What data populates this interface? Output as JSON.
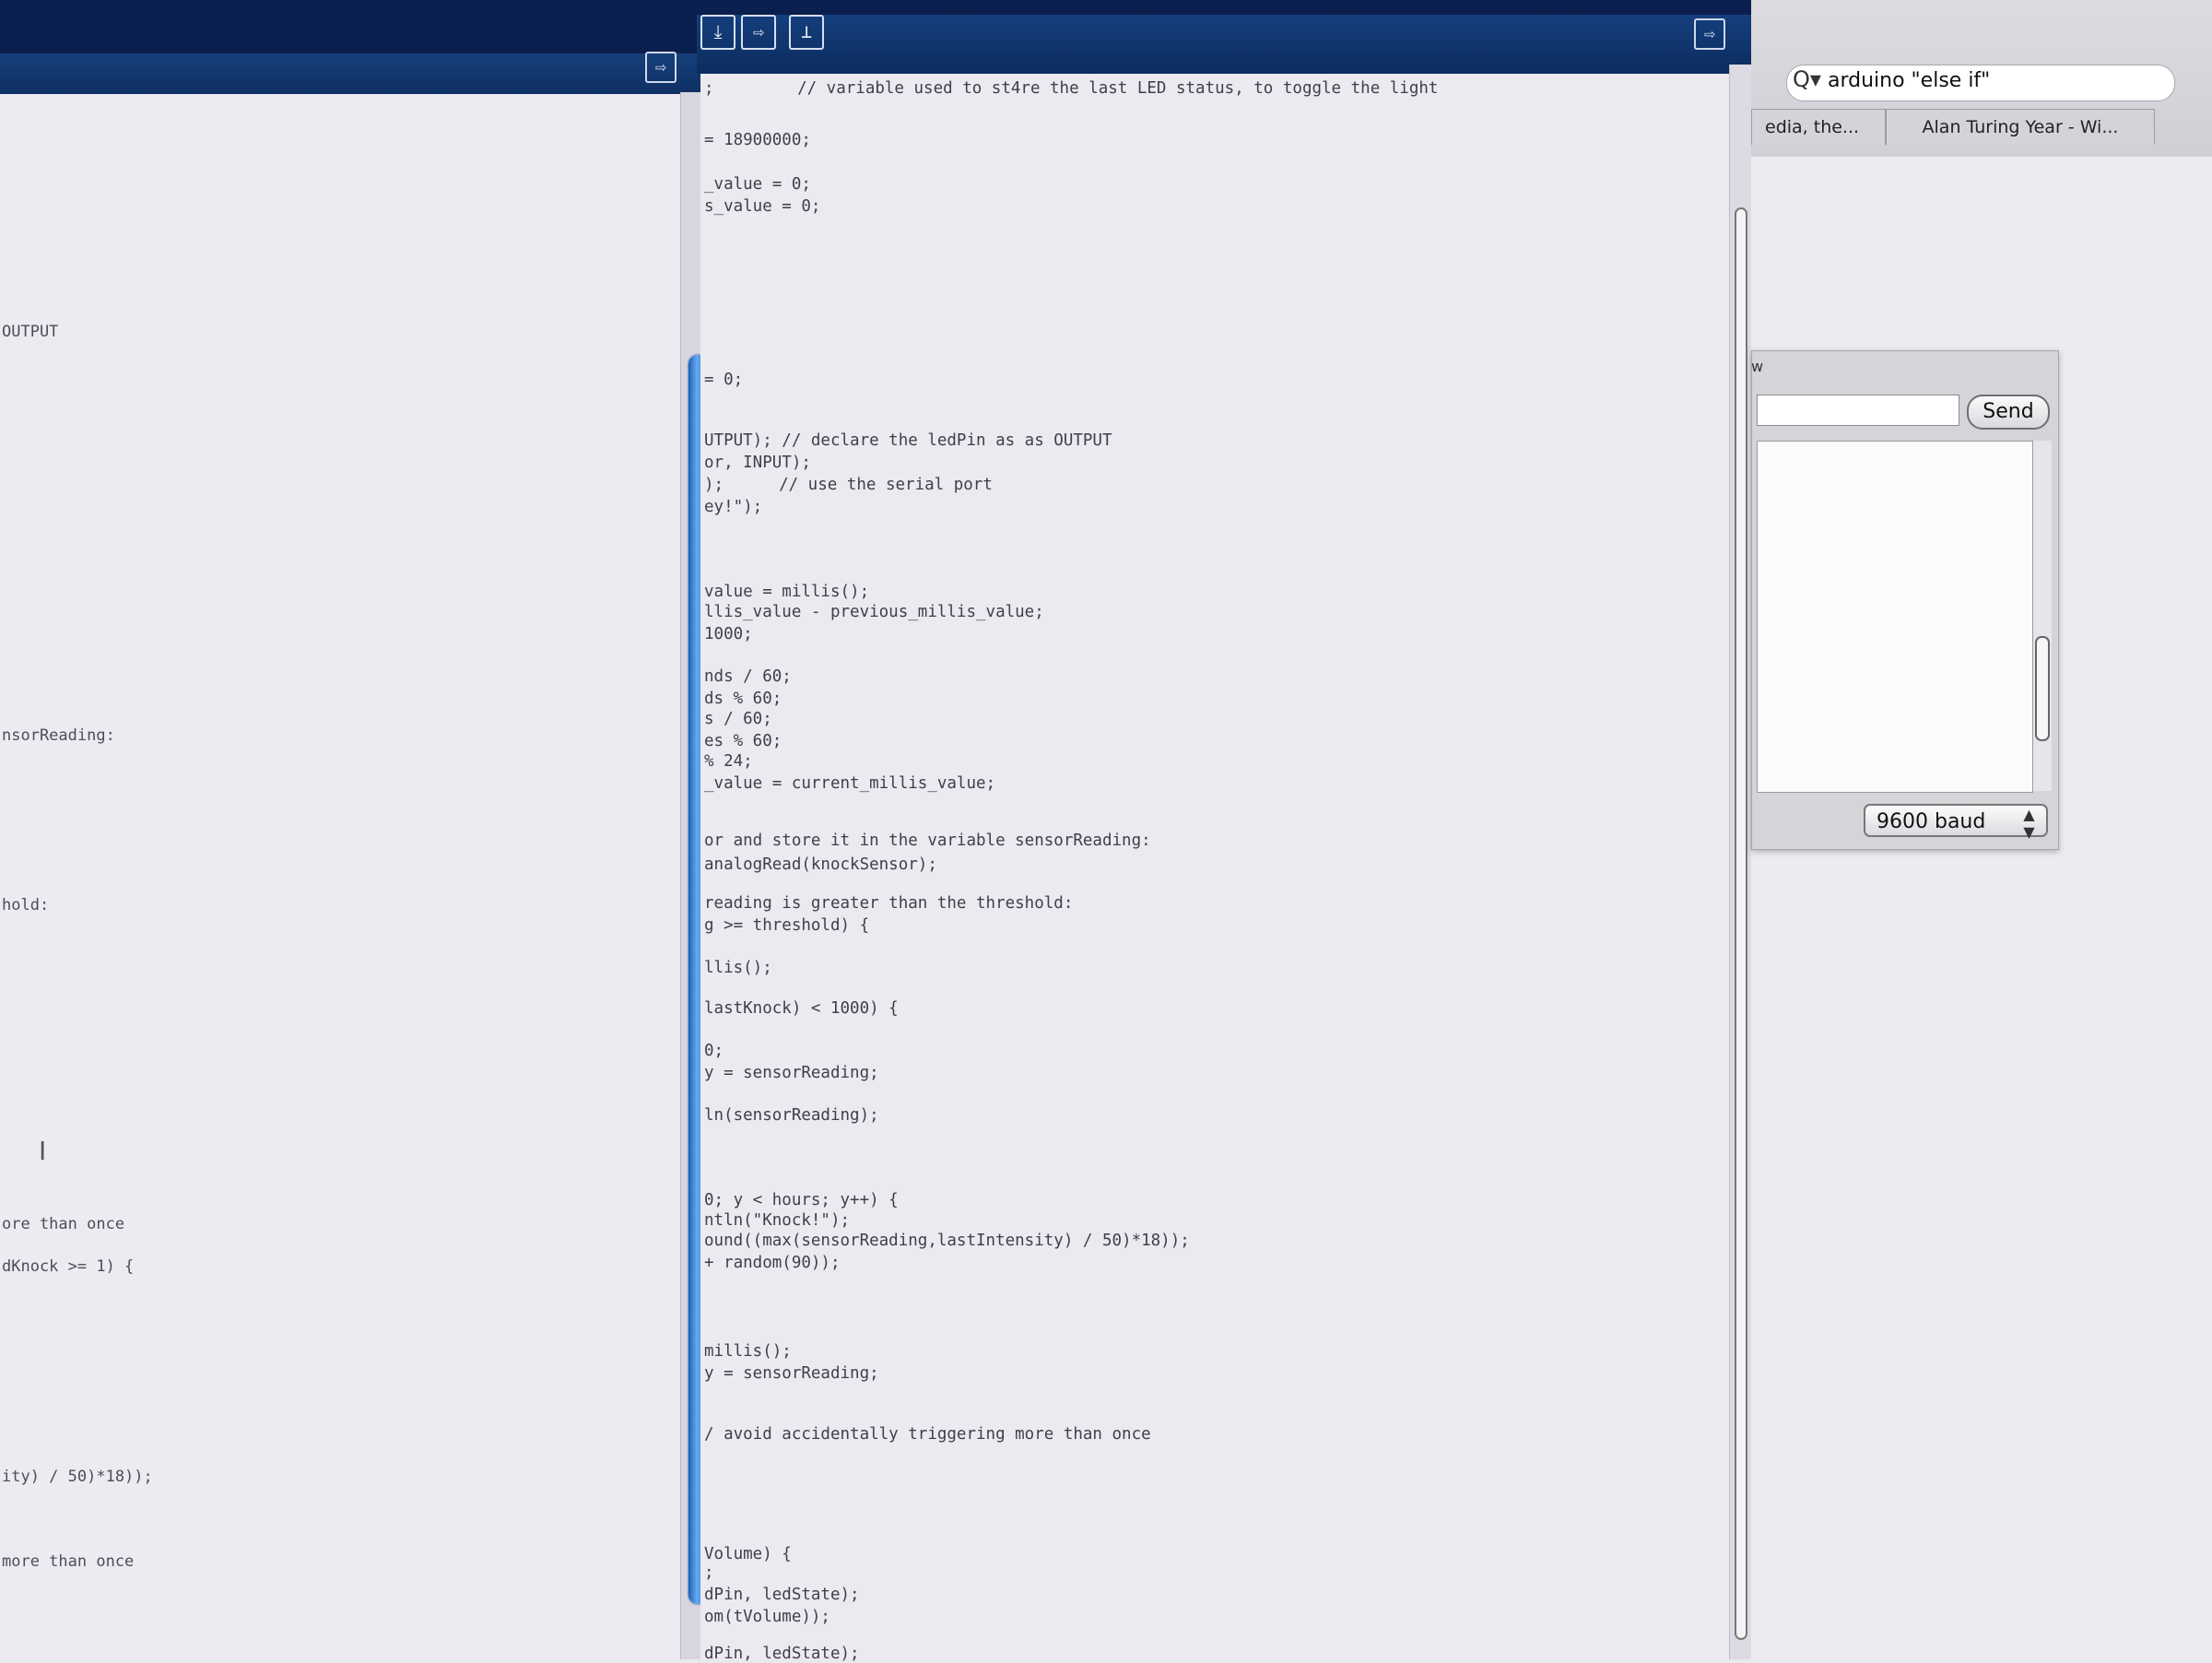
{
  "left_editor": {
    "lines": [
      "OUTPUT",
      "nsorReading:",
      "hold:",
      "ore than once",
      "dKnock >= 1) {",
      "ity) / 50)*18));",
      "more than once"
    ]
  },
  "center_editor": {
    "lines": [
      "; ",
      "= 18900000;",
      "_value = 0;",
      "s_value = 0;",
      "= 0;",
      "UTPUT); // declare the ledPin as as OUTPUT",
      "or, INPUT);",
      ");",
      "ey!\");",
      "value = millis();",
      "llis_value - previous_millis_value;",
      "1000;",
      "nds / 60;",
      "ds % 60;",
      "s / 60;",
      "es % 60;",
      "% 24;",
      "_value = current_millis_value;",
      "or and store it in the variable sensorReading:",
      "analogRead(knockSensor);",
      "reading is greater than the threshold:",
      "g >= threshold) {",
      "llis();",
      "lastKnock) < 1000) {",
      "0;",
      "y = sensorReading;",
      "ln(sensorReading);",
      "0; y < hours; y++) {",
      "ntln(\"Knock!\");",
      "ound((max(sensorReading,lastIntensity) / 50)*18));",
      "+ random(90));",
      "millis();",
      "y = sensorReading;",
      "/ avoid accidentally triggering more than once",
      "Volume) {",
      ";",
      "dPin, ledState);",
      "om(tVolume));",
      "dPin, ledState);"
    ],
    "comments": {
      "c1": "// variable used to st4re the last LED status, to toggle the light",
      "c2": "// use the serial port"
    }
  },
  "browser": {
    "search_query": "arduino \"else if\"",
    "tabs": [
      "edia, the...",
      "Alan Turing Year - Wi..."
    ]
  },
  "serial_monitor": {
    "title_fragment": "w",
    "send_label": "Send",
    "baud": "9600 baud"
  },
  "icons": {
    "left_export": "⇨",
    "center_export": "⇨",
    "toolbar": [
      "⤓",
      "⇨",
      "⊥"
    ],
    "search": "Q▾",
    "baud_arrows": "▲▼"
  }
}
